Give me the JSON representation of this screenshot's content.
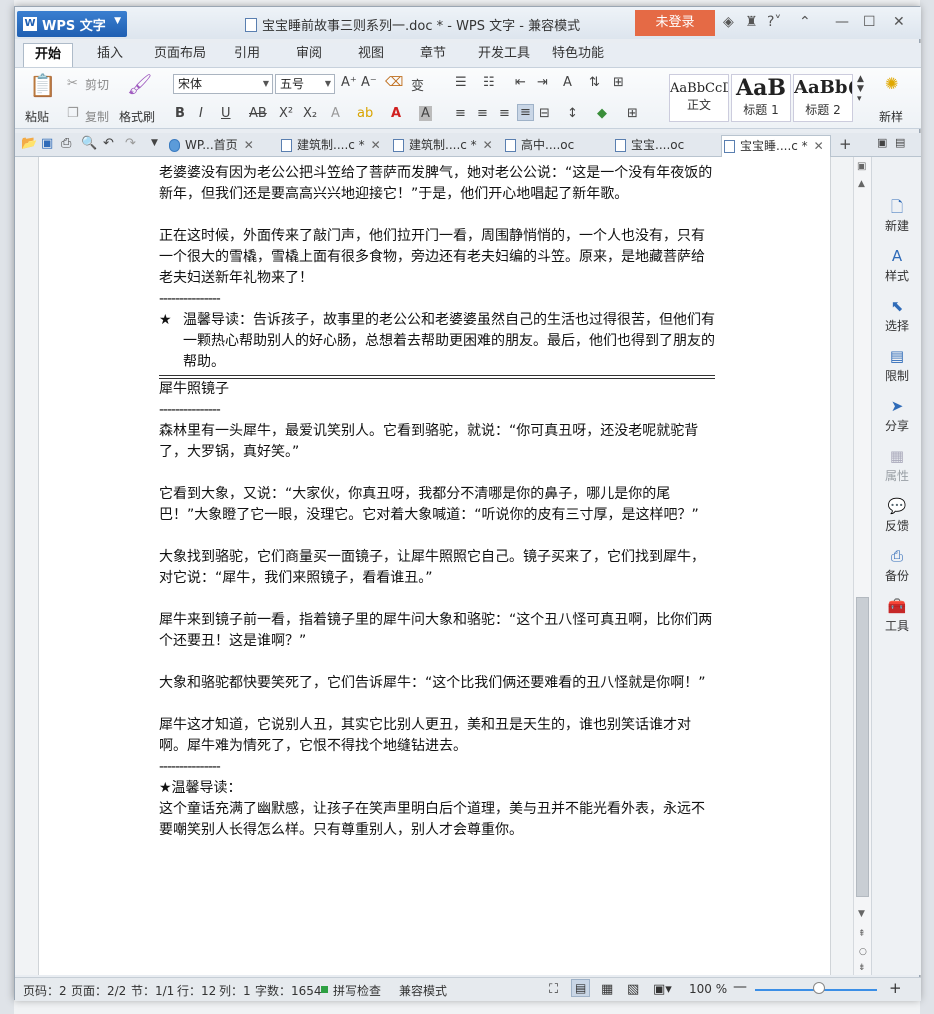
{
  "app": {
    "name": "WPS 文字",
    "login": "未登录"
  },
  "window": {
    "title": "宝宝睡前故事三则系列一.doc * - WPS 文字 - 兼容模式"
  },
  "menu_tabs": [
    "开始",
    "插入",
    "页面布局",
    "引用",
    "审阅",
    "视图",
    "章节",
    "开发工具",
    "特色功能"
  ],
  "ribbon": {
    "paste": "粘贴",
    "cut": "剪切",
    "copy": "复制",
    "format_painter": "格式刷",
    "font_name": "宋体",
    "font_size": "五号",
    "styles": [
      {
        "sample": "AaBbCcD",
        "name": "正文"
      },
      {
        "sample": "AaB",
        "name": "标题 1"
      },
      {
        "sample": "AaBb(",
        "name": "标题 2"
      }
    ],
    "new_style": "新样"
  },
  "doc_tabs": [
    {
      "label": "WP...首页"
    },
    {
      "label": "建筑制....c *"
    },
    {
      "label": "建筑制....c *"
    },
    {
      "label": "高中....oc"
    },
    {
      "label": "宝宝....oc"
    },
    {
      "label": "宝宝睡....c *"
    }
  ],
  "document": {
    "p1": "老婆婆没有因为老公公把斗笠给了菩萨而发脾气，她对老公公说：“这是一个没有年夜饭的新年，但我们还是要高高兴兴地迎接它！”于是，他们开心地唱起了新年歌。",
    "p2": "正在这时候，外面传来了敲门声，他们拉开门一看，周围静悄悄的，一个人也没有，只有一个很大的雪橇，雪橇上面有很多食物，旁边还有老夫妇编的斗笠。原来，是地藏菩萨给老夫妇送新年礼物来了！",
    "sep1": "---------------",
    "star": "★",
    "tip1": "温馨导读：告诉孩子，故事里的老公公和老婆婆虽然自己的生活也过得很苦，但他们有一颗热心帮助别人的好心肠，总想着去帮助更困难的朋友。最后，他们也得到了朋友的帮助。",
    "title2": "犀牛照镜子",
    "sep2": "---------------",
    "p3": "森林里有一头犀牛，最爱讥笑别人。它看到骆驼，就说：“你可真丑呀，还没老呢就驼背了，大罗锅，真好笑。”",
    "p4": "它看到大象，又说：“大家伙，你真丑呀，我都分不清哪是你的鼻子，哪儿是你的尾巴！”大象瞪了它一眼，没理它。它对着大象喊道：“听说你的皮有三寸厚，是这样吧？”",
    "p5": "大象找到骆驼，它们商量买一面镜子，让犀牛照照它自己。镜子买来了，它们找到犀牛，对它说：“犀牛，我们来照镜子，看看谁丑。”",
    "p6": "犀牛来到镜子前一看，指着镜子里的犀牛问大象和骆驼：“这个丑八怪可真丑啊，比你们两个还要丑！这是谁啊？”",
    "p7": "大象和骆驼都快要笑死了，它们告诉犀牛：“这个比我们俩还要难看的丑八怪就是你啊！”",
    "p8": "犀牛这才知道，它说别人丑，其实它比别人更丑，美和丑是天生的，谁也别笑话谁才对啊。犀牛难为情死了，它恨不得找个地缝钻进去。",
    "sep3": "---------------",
    "tip2": "★温馨导读：",
    "p9": "这个童话充满了幽默感，让孩子在笑声里明白后个道理，美与丑并不能光看外表，永远不要嘲笑别人长得怎么样。只有尊重别人，别人才会尊重你。"
  },
  "side_panel": [
    "新建",
    "样式",
    "选择",
    "限制",
    "分享",
    "属性",
    "反馈",
    "备份",
    "工具"
  ],
  "status": {
    "page_code": "页码：2",
    "pages": "页面：2/2",
    "section": "节：1/1",
    "row": "行：12",
    "col": "列：1",
    "words": "字数：1654",
    "spell": "拼写检查",
    "compat": "兼容模式",
    "zoom": "100 %"
  },
  "colors": {
    "accent": "#2f6bb8",
    "login": "#e56a45"
  }
}
